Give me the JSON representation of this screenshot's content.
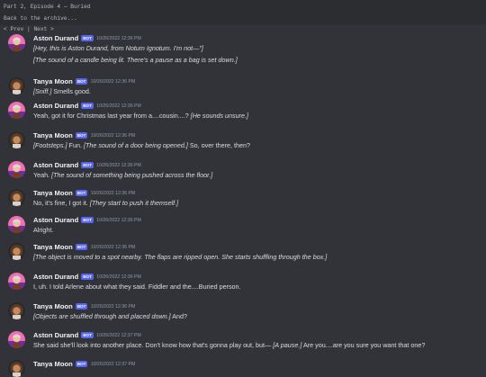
{
  "header": {
    "title": "Part 2, Episode 4 — Buried",
    "back_link": "Back to the archive...",
    "nav_open": "< ",
    "prev_label": "Prev",
    "nav_sep": " | ",
    "next_label": "Next",
    "nav_close": " >"
  },
  "colors": {
    "background": "#313338",
    "bot_badge": "#5865f2"
  },
  "bot_badge_label": "BOT",
  "messages": [
    {
      "author": "Aston Durand",
      "time": "10/26/2022 12:36 PM",
      "lines": [
        [
          {
            "t": "[Hey, this is Aston Durand, from Notum Ignotum. I'm not—\"]",
            "i": true
          }
        ],
        [
          {
            "t": "[The sound of a candle being lit. There's a pause as a bag is set down.]",
            "i": true
          }
        ]
      ]
    },
    {
      "author": "Tanya Moon",
      "time": "10/26/2022 12:36 PM",
      "lines": [
        [
          {
            "t": "[Sniff.]",
            "i": true
          },
          {
            "t": " Smells good.",
            "i": false
          }
        ]
      ]
    },
    {
      "author": "Aston Durand",
      "time": "10/26/2022 12:36 PM",
      "lines": [
        [
          {
            "t": "Yeah, got it for Christmas last year from a....cousin....? ",
            "i": false
          },
          {
            "t": "[He sounds unsure.]",
            "i": true
          }
        ]
      ]
    },
    {
      "author": "Tanya Moon",
      "time": "10/26/2022 12:36 PM",
      "lines": [
        [
          {
            "t": "[Footsteps.]",
            "i": true
          },
          {
            "t": " Fun. ",
            "i": false
          },
          {
            "t": "[The sound of a door being opened.]",
            "i": true
          },
          {
            "t": " So, over there, then?",
            "i": false
          }
        ]
      ]
    },
    {
      "author": "Aston Durand",
      "time": "10/26/2022 12:36 PM",
      "lines": [
        [
          {
            "t": "Yeah. ",
            "i": false
          },
          {
            "t": "[The sound of something being pushed across the floor.]",
            "i": true
          }
        ]
      ]
    },
    {
      "author": "Tanya Moon",
      "time": "10/26/2022 12:36 PM",
      "lines": [
        [
          {
            "t": "No, it's fine, I got it. ",
            "i": false
          },
          {
            "t": "[They start to push it themself.]",
            "i": true
          }
        ]
      ]
    },
    {
      "author": "Aston Durand",
      "time": "10/26/2022 12:36 PM",
      "lines": [
        [
          {
            "t": "Alright.",
            "i": false
          }
        ]
      ]
    },
    {
      "author": "Tanya Moon",
      "time": "10/26/2022 12:36 PM",
      "lines": [
        [
          {
            "t": "[The object is moved to a spot nearby. The flaps are ripped open. She starts shuffling through the box.]",
            "i": true
          }
        ]
      ]
    },
    {
      "author": "Aston Durand",
      "time": "10/26/2022 12:36 PM",
      "lines": [
        [
          {
            "t": "I, uh. I told Arlene about what they said. Fiddler and the....Buried person.",
            "i": false
          }
        ]
      ]
    },
    {
      "author": "Tanya Moon",
      "time": "10/26/2022 12:36 PM",
      "lines": [
        [
          {
            "t": "[Objects are shuffled through and placed down.]",
            "i": true
          },
          {
            "t": " And?",
            "i": false
          }
        ]
      ]
    },
    {
      "author": "Aston Durand",
      "time": "10/26/2022 12:37 PM",
      "lines": [
        [
          {
            "t": "She said she'll look into another place. Don't know how that's gonna play out, but— ",
            "i": false
          },
          {
            "t": "[A pause.]",
            "i": true
          },
          {
            "t": " Are you....are you sure you want that one?",
            "i": false
          }
        ]
      ]
    },
    {
      "author": "Tanya Moon",
      "time": "10/26/2022 12:37 PM",
      "lines": []
    }
  ]
}
